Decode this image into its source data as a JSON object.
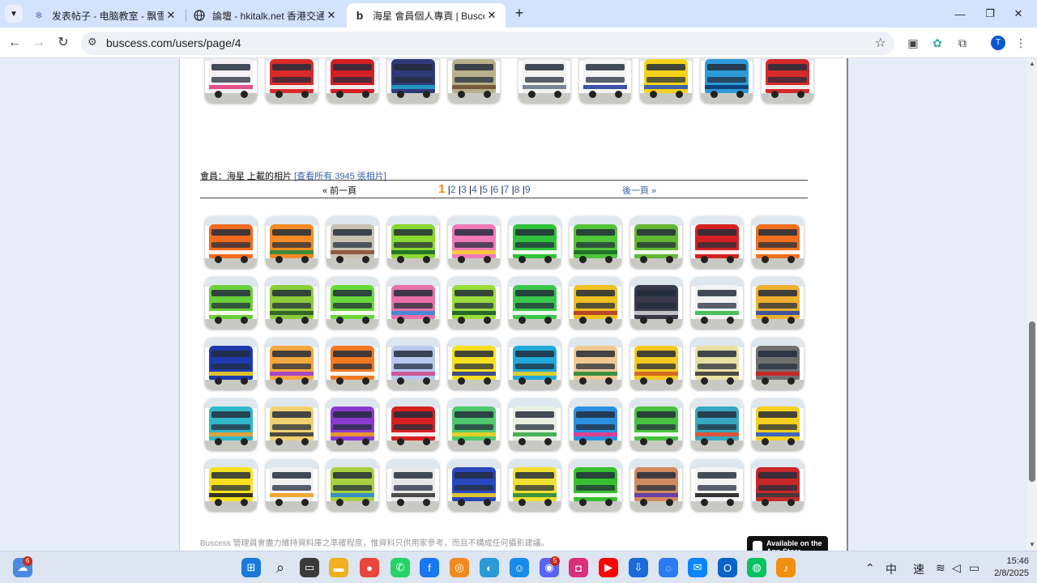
{
  "browser": {
    "tabs": [
      {
        "title": "发表帖子 - 电脑教室 - 飘雪粤语",
        "favicon": "sticker-icon",
        "active": false
      },
      {
        "title": "論壇 - hkitalk.net 香港交通資訊",
        "favicon": "globe-icon",
        "active": false
      },
      {
        "title": "海星 會員個人專頁 | Buscess 香港",
        "favicon": "buscess-b-icon",
        "active": true
      }
    ],
    "url": "buscess.com/users/page/4",
    "profile_initial": "T"
  },
  "page": {
    "member_label": "會員：海星 上載的相片",
    "view_all_link": "[查看所有 3945 張相片]",
    "pagination": {
      "prev": "« 前一頁",
      "current": "1",
      "pages": [
        "2",
        "3",
        "4",
        "5",
        "6",
        "7",
        "8",
        "9"
      ],
      "next": "後一頁 »"
    },
    "footer_text": "Buscess 管理員會盡力維持資料庫之準確程度，惟資料只供用家參考，而且不構成任何攝影建議。",
    "appstore_label": "Available on the App Store",
    "top_strip": [
      {
        "body": "#f5f0f4",
        "stripe": "#e0407a"
      },
      {
        "body": "#d92b2b",
        "stripe": "#ffffff"
      },
      {
        "body": "#d41f26",
        "stripe": "#ffffff"
      },
      {
        "body": "#2f3a78",
        "stripe": "#1fa3c8"
      },
      {
        "body": "#b8b08a",
        "stripe": "#705030"
      },
      {
        "body": "#f2f2ee",
        "stripe": "#6a7a8a"
      },
      {
        "body": "#f4f4f4",
        "stripe": "#2a3da0"
      },
      {
        "body": "#f7d21c",
        "stripe": "#2a55b8"
      },
      {
        "body": "#2f9ad8",
        "stripe": "#0a3a70"
      },
      {
        "body": "#d42a2a",
        "stripe": "#ffffff"
      }
    ],
    "grid": [
      {
        "body": "#f26b1f",
        "stripe": "#ffffff"
      },
      {
        "body": "#f58a25",
        "stripe": "#2a8a3a"
      },
      {
        "body": "#c9c2b3",
        "stripe": "#8a5030"
      },
      {
        "body": "#8ad830",
        "stripe": "#1a6a2a"
      },
      {
        "body": "#f07ab8",
        "stripe": "#f4d430"
      },
      {
        "body": "#2fc23a",
        "stripe": "#ffffff"
      },
      {
        "body": "#52c43a",
        "stripe": "#1a6a2a"
      },
      {
        "body": "#62b832",
        "stripe": "#ffffff"
      },
      {
        "body": "#d42020",
        "stripe": "#ffffff"
      },
      {
        "body": "#f07020",
        "stripe": "#ffffff"
      },
      {
        "body": "#6ad03a",
        "stripe": "#ffffff"
      },
      {
        "body": "#8ccc3a",
        "stripe": "#2a5a2a"
      },
      {
        "body": "#6ad83a",
        "stripe": "#ffffff"
      },
      {
        "body": "#e872a8",
        "stripe": "#3a8ad8"
      },
      {
        "body": "#9adc3a",
        "stripe": "#1a5a2a"
      },
      {
        "body": "#3ac84a",
        "stripe": "#ffffff"
      },
      {
        "body": "#f0c020",
        "stripe": "#b03a2a"
      },
      {
        "body": "#3a3a4a",
        "stripe": "#d0d0d0"
      },
      {
        "body": "#f2f2f2",
        "stripe": "#3ab84a"
      },
      {
        "body": "#f0b030",
        "stripe": "#2a4aa8"
      },
      {
        "body": "#1e3ab0",
        "stripe": "#f0d020"
      },
      {
        "body": "#f4a840",
        "stripe": "#a03ad0"
      },
      {
        "body": "#f07a20",
        "stripe": "#ffffff"
      },
      {
        "body": "#b8c8f0",
        "stripe": "#d04a8a"
      },
      {
        "body": "#f4e020",
        "stripe": "#2a3a90"
      },
      {
        "body": "#20a8d8",
        "stripe": "#f0d020"
      },
      {
        "body": "#f0c890",
        "stripe": "#2a8a3a"
      },
      {
        "body": "#f4c820",
        "stripe": "#d06020"
      },
      {
        "body": "#e8e0a0",
        "stripe": "#3a3a3a"
      },
      {
        "body": "#707070",
        "stripe": "#d02020"
      },
      {
        "body": "#30b8c8",
        "stripe": "#f0a030"
      },
      {
        "body": "#f0d070",
        "stripe": "#3a3a3a"
      },
      {
        "body": "#8a3ad0",
        "stripe": "#f0a020"
      },
      {
        "body": "#d82020",
        "stripe": "#ffffff"
      },
      {
        "body": "#50c870",
        "stripe": "#f0d020"
      },
      {
        "body": "#e8f0e0",
        "stripe": "#3aa84a"
      },
      {
        "body": "#2a90e0",
        "stripe": "#f03a8a"
      },
      {
        "body": "#48c040",
        "stripe": "#ffffff"
      },
      {
        "body": "#38a8c0",
        "stripe": "#f04a2a"
      },
      {
        "body": "#f8d020",
        "stripe": "#2a5ad0"
      },
      {
        "body": "#f8e020",
        "stripe": "#202020"
      },
      {
        "body": "#f0f0f0",
        "stripe": "#f0a020"
      },
      {
        "body": "#a8d040",
        "stripe": "#2a8ad0"
      },
      {
        "body": "#e8e8e8",
        "stripe": "#3a3a3a"
      },
      {
        "body": "#2a48c0",
        "stripe": "#f0d020"
      },
      {
        "body": "#f0e030",
        "stripe": "#2a8a3a"
      },
      {
        "body": "#38c030",
        "stripe": "#ffffff"
      },
      {
        "body": "#d08a60",
        "stripe": "#5a3ab0"
      },
      {
        "body": "#f4f4f4",
        "stripe": "#202020"
      },
      {
        "body": "#c82828",
        "stripe": "#3a3a3a"
      }
    ]
  },
  "taskbar": {
    "weather_badge": "6",
    "discord_badge": "5",
    "ime_1": "中",
    "ime_2": "速",
    "time": "15:46",
    "date": "2/8/2025"
  }
}
